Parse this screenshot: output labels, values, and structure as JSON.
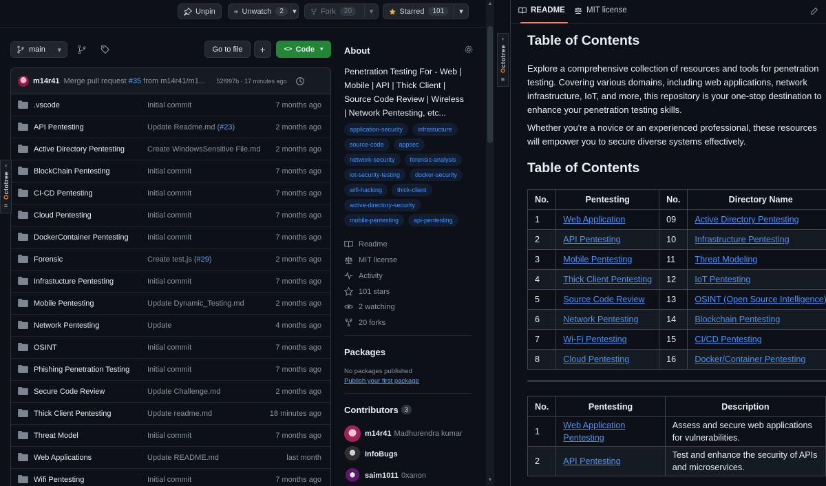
{
  "topbar": {
    "unpin": "Unpin",
    "unwatch": "Unwatch",
    "watch_count": "2",
    "fork": "Fork",
    "fork_count": "20",
    "starred": "Starred",
    "star_count": "101"
  },
  "repo": {
    "branch": "main",
    "go_to_file": "Go to file",
    "add": "+",
    "code": "Code",
    "code_glyph": "<>"
  },
  "commit": {
    "author": "m14r41",
    "message_prefix": "Merge pull request ",
    "pr": "#35",
    "message_suffix": " from m14r41/m1...",
    "hash_time": "52f997b · 17 minutes ago"
  },
  "files": [
    {
      "name": ".vscode",
      "msg": "Initial commit",
      "pr": "",
      "msg_end": "",
      "time": "7 months ago"
    },
    {
      "name": "API Pentesting",
      "msg": "Update Readme.md (",
      "pr": "#23",
      "msg_end": ")",
      "time": "2 months ago"
    },
    {
      "name": "Active Directory Pentesting",
      "msg": "Create WindowsSensitive File.md",
      "pr": "",
      "msg_end": "",
      "time": "2 months ago"
    },
    {
      "name": "BlockChain Pentesting",
      "msg": "Initial commit",
      "pr": "",
      "msg_end": "",
      "time": "7 months ago"
    },
    {
      "name": "CI-CD Pentesting",
      "msg": "Initial commit",
      "pr": "",
      "msg_end": "",
      "time": "7 months ago"
    },
    {
      "name": "Cloud Pentesting",
      "msg": "Initial commit",
      "pr": "",
      "msg_end": "",
      "time": "7 months ago"
    },
    {
      "name": "DockerContainer Pentesting",
      "msg": "Initial commit",
      "pr": "",
      "msg_end": "",
      "time": "7 months ago"
    },
    {
      "name": "Forensic",
      "msg": "Create test.js (",
      "pr": "#29",
      "msg_end": ")",
      "time": "2 months ago"
    },
    {
      "name": "Infrastucture Pentesting",
      "msg": "Initial commit",
      "pr": "",
      "msg_end": "",
      "time": "7 months ago"
    },
    {
      "name": "Mobile Pentesting",
      "msg": "Update Dynamic_Testing.md",
      "pr": "",
      "msg_end": "",
      "time": "2 months ago"
    },
    {
      "name": "Network Pentesting",
      "msg": "Update",
      "pr": "",
      "msg_end": "",
      "time": "4 months ago"
    },
    {
      "name": "OSINT",
      "msg": "Initial commit",
      "pr": "",
      "msg_end": "",
      "time": "7 months ago"
    },
    {
      "name": "Phishing Penetration Testing",
      "msg": "Initial commit",
      "pr": "",
      "msg_end": "",
      "time": "7 months ago"
    },
    {
      "name": "Secure Code Review",
      "msg": "Update Challenge.md",
      "pr": "",
      "msg_end": "",
      "time": "2 months ago"
    },
    {
      "name": "Thick Client Pentesting",
      "msg": "Update readme.md",
      "pr": "",
      "msg_end": "",
      "time": "18 minutes ago"
    },
    {
      "name": "Threat Model",
      "msg": "Initial commit",
      "pr": "",
      "msg_end": "",
      "time": "7 months ago"
    },
    {
      "name": "Web Applications",
      "msg": "Update README.md",
      "pr": "",
      "msg_end": "",
      "time": "last month"
    },
    {
      "name": "Wifi Pentesting",
      "msg": "Initial commit",
      "pr": "",
      "msg_end": "",
      "time": "7 months ago"
    }
  ],
  "about": {
    "title": "About",
    "description": "Penetration Testing For - Web | Mobile | API | Thick Client | Source Code Review | Wireless | Network Pentesting, etc...",
    "topics": [
      "application-security",
      "infrastucture",
      "source-code",
      "appsec",
      "network-security",
      "forensic-analysis",
      "iot-security-testing",
      "docker-security",
      "wifi-hacking",
      "thick-client",
      "active-directory-security",
      "mobile-pentesting",
      "api-pentesting"
    ],
    "meta": {
      "readme": "Readme",
      "license": "MIT license",
      "activity": "Activity",
      "stars": "101 stars",
      "watching": "2 watching",
      "forks": "20 forks"
    },
    "packages_title": "Packages",
    "packages_none": "No packages published",
    "packages_link": "Publish your first package",
    "contributors_title": "Contributors",
    "contributors_count": "3",
    "contributors": [
      {
        "login": "m14r41",
        "name": "Madhurendra kumar"
      },
      {
        "login": "InfoBugs",
        "name": ""
      },
      {
        "login": "saim1011",
        "name": "0xanon"
      }
    ]
  },
  "octotree": {
    "label_o": "O",
    "label_rest": "ctotree"
  },
  "readme": {
    "tab_readme": "README",
    "tab_license": "MIT license",
    "h1": "Table of Contents",
    "p1": "Explore a comprehensive collection of resources and tools for penetration testing. Covering various domains, including web applications, network infrastructure, IoT, and more, this repository is your one-stop destination to enhance your penetration testing skills.",
    "p2": "Whether you're a novice or an experienced professional, these resources will empower you to secure diverse systems effectively.",
    "h2": "Table of Contents",
    "toc_headers": [
      "No.",
      "Pentesting",
      "No.",
      "Directory Name"
    ],
    "toc_rows": [
      [
        "1",
        "Web Application",
        "09",
        "Active Directory Pentesting"
      ],
      [
        "2",
        "API Pentesting",
        "10",
        "Infrastructure Pentesting"
      ],
      [
        "3",
        "Mobile Pentesting",
        "11",
        "Threat Modeling"
      ],
      [
        "4",
        "Thick Client Pentesting",
        "12",
        "IoT Pentesting"
      ],
      [
        "5",
        "Source Code Review",
        "13",
        "OSINT (Open Source Intelligence)"
      ],
      [
        "6",
        "Network Pentesting",
        "14",
        "Blockchain Pentesting"
      ],
      [
        "7",
        "Wi-Fi Pentesting",
        "15",
        "CI/CD Pentesting"
      ],
      [
        "8",
        "Cloud Pentesting",
        "16",
        "Docker/Container Pentesting"
      ]
    ],
    "desc_headers": [
      "No.",
      "Pentesting",
      "Description"
    ],
    "desc_rows": [
      [
        "1",
        "Web Application Pentesting",
        "Assess and secure web applications for vulnerabilities."
      ],
      [
        "2",
        "API Pentesting",
        "Test and enhance the security of APIs and microservices."
      ]
    ]
  }
}
